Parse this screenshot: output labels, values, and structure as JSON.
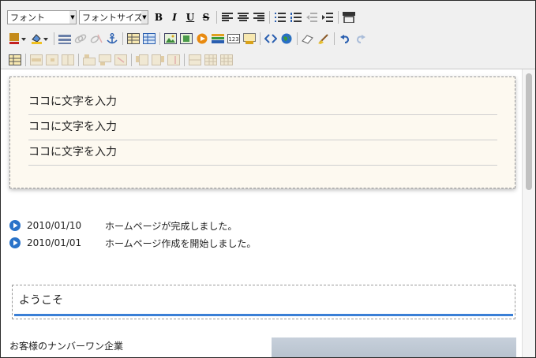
{
  "toolbar": {
    "font_select": "フォント",
    "font_size_select": "フォントサイズ",
    "bold": "B",
    "italic": "I",
    "underline": "U",
    "strike": "S"
  },
  "content": {
    "box_lines": [
      "ココに文字を入力",
      "ココに文字を入力",
      "ココに文字を入力"
    ],
    "news": [
      {
        "date": "2010/01/10",
        "text": "ホームページが完成しました。"
      },
      {
        "date": "2010/01/01",
        "text": "ホームページ作成を開始しました。"
      }
    ],
    "welcome_heading": "ようこそ",
    "lead_text": "お客様のナンバーワン企業"
  },
  "colors": {
    "accent": "#3a7fd6",
    "box_bg": "#fdf9f0",
    "bullet": "#2a73c9"
  }
}
